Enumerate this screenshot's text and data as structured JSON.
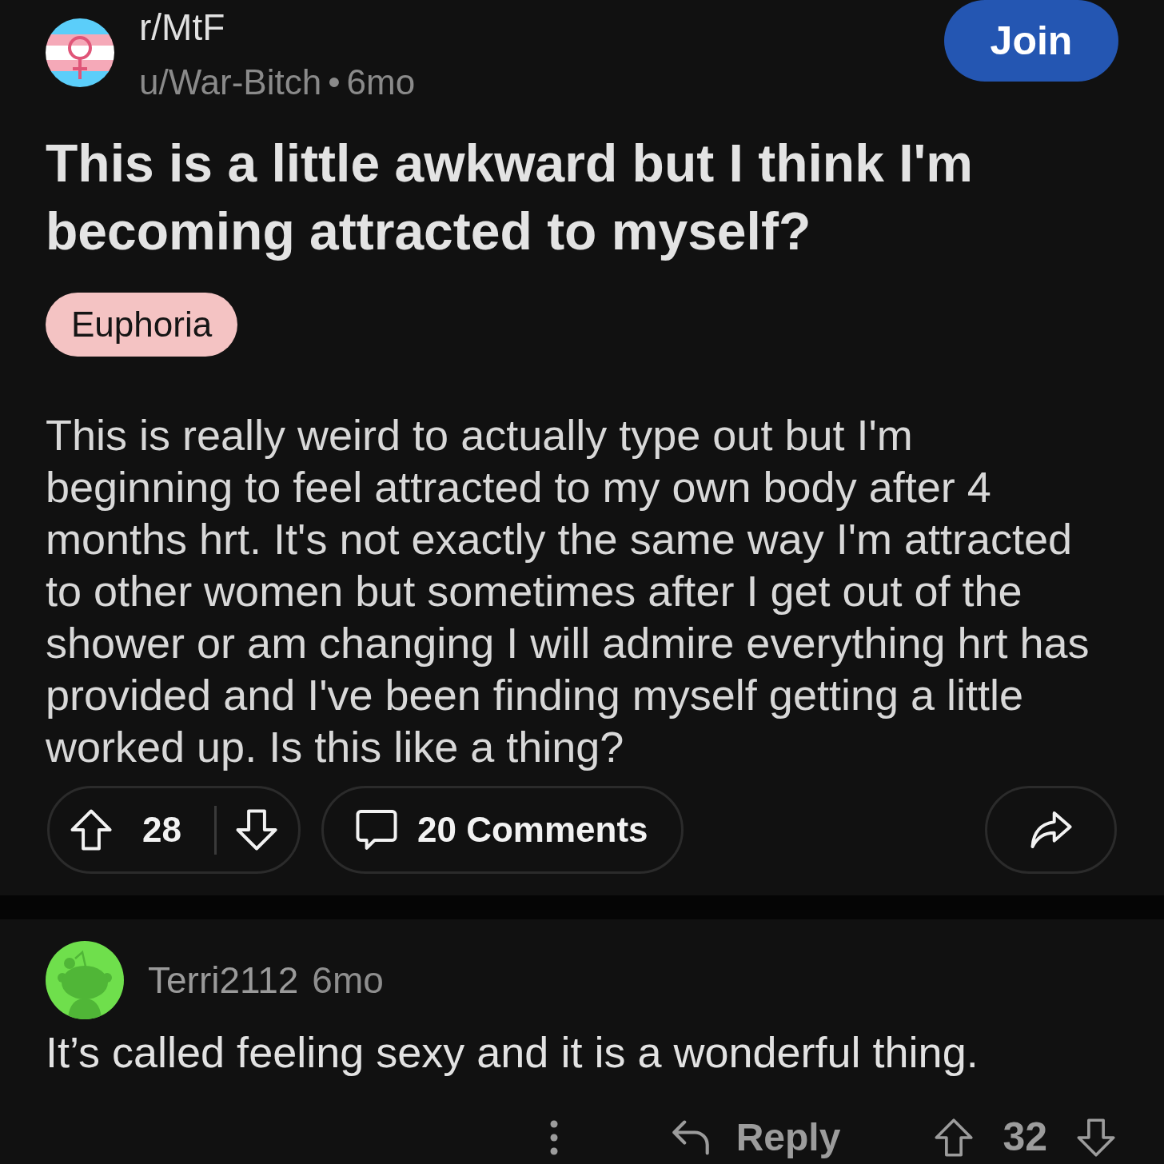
{
  "post": {
    "subreddit": "r/MtF",
    "author": "u/War-Bitch",
    "separator": "•",
    "age": "6mo",
    "join_label": "Join",
    "title": "This is a little awkward but I think I'm becoming attracted to myself?",
    "flair": "Euphoria",
    "body": "This is really weird to actually type out but I'm beginning to feel attracted to my own body after 4 months hrt. It's not exactly the same way I'm attracted to other women but sometimes after I get out of the shower or am changing I will admire everything hrt has provided and I've been finding myself getting a little worked up. Is this like a thing?",
    "score": "28",
    "comments_label": "20 Comments"
  },
  "comments": [
    {
      "author": "Terri2112",
      "age": "6mo",
      "text": "It’s called feeling sexy and it is a wonderful thing.",
      "reply_label": "Reply",
      "score": "32"
    }
  ]
}
